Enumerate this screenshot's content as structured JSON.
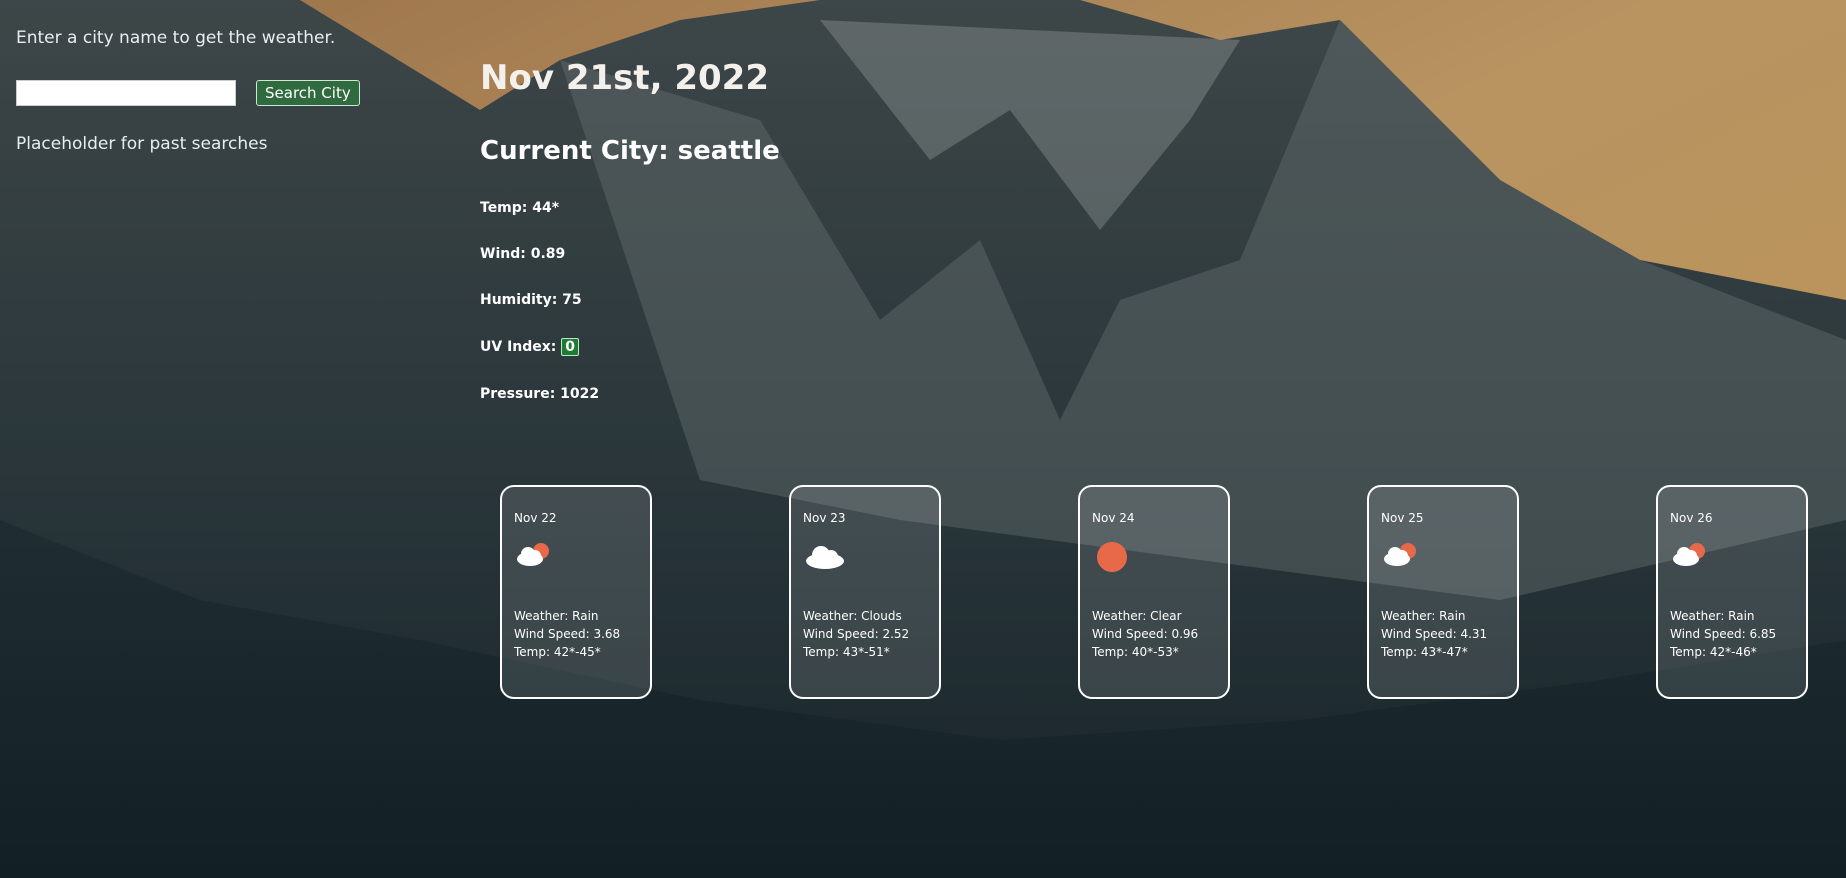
{
  "sidebar": {
    "hint": "Enter a city name to get the weather.",
    "search": {
      "value": "",
      "placeholder": ""
    },
    "button_label": "Search City",
    "past_searches": "Placeholder for past searches"
  },
  "current": {
    "date": "Nov 21st, 2022",
    "city": "Current City: seattle",
    "temp": "Temp: 44*",
    "wind": "Wind: 0.89",
    "humidity": "Humidity: 75",
    "uv_label": "UV Index: ",
    "uv_value": "0",
    "pressure": "Pressure: 1022"
  },
  "forecast": [
    {
      "date": "Nov 22",
      "icon": "sun-behind-cloud-icon",
      "weather": "Weather: Rain",
      "wind": "Wind Speed: 3.68",
      "temp": "Temp: 42*-45*"
    },
    {
      "date": "Nov 23",
      "icon": "cloud-icon",
      "weather": "Weather: Clouds",
      "wind": "Wind Speed: 2.52",
      "temp": "Temp: 43*-51*"
    },
    {
      "date": "Nov 24",
      "icon": "sun-icon",
      "weather": "Weather: Clear",
      "wind": "Wind Speed: 0.96",
      "temp": "Temp: 40*-53*"
    },
    {
      "date": "Nov 25",
      "icon": "sun-behind-cloud-icon",
      "weather": "Weather: Rain",
      "wind": "Wind Speed: 4.31",
      "temp": "Temp: 43*-47*"
    },
    {
      "date": "Nov 26",
      "icon": "sun-behind-cloud-icon",
      "weather": "Weather: Rain",
      "wind": "Wind Speed: 6.85",
      "temp": "Temp: 42*-46*"
    }
  ],
  "colors": {
    "button": "#2f6b3f",
    "uv_badge": "#1f7a32",
    "sun": "#e8694a"
  }
}
